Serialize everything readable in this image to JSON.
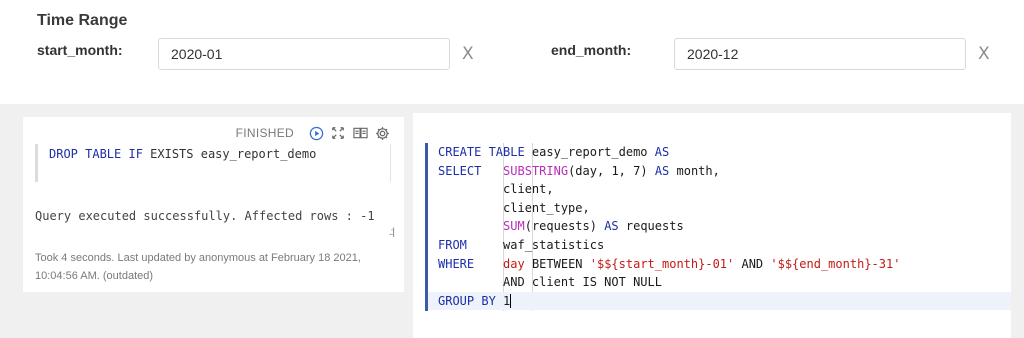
{
  "time_range": {
    "title": "Time Range",
    "start_label": "start_month:",
    "start_value": "2020-01",
    "end_label": "end_month:",
    "end_value": "2020-12",
    "clear_glyph": "X"
  },
  "left_cell": {
    "status": "FINISHED",
    "code": "DROP TABLE IF EXISTS easy_report_demo",
    "result": "Query executed successfully. Affected rows : -1",
    "footer": "Took 4 seconds. Last updated by anonymous at February 18 2021, 10:04:56 AM. (outdated)",
    "icons": [
      "run-icon",
      "expand-icon",
      "book-icon",
      "gear-icon"
    ]
  },
  "editor": {
    "lines": [
      "CREATE TABLE easy_report_demo AS",
      "SELECT   SUBSTRING(day, 1, 7) AS month,",
      "         client,",
      "         client_type,",
      "         SUM(requests) AS requests",
      "FROM     waf_statistics",
      "WHERE    day BETWEEN '$${start_month}-01' AND '$${end_month}-31'",
      "         AND client IS NOT NULL",
      "GROUP BY 1"
    ]
  },
  "colors": {
    "keyword": "#1d2ea8",
    "function": "#b82fb8",
    "string": "#c41a16",
    "accent": "#3a5ba7"
  }
}
